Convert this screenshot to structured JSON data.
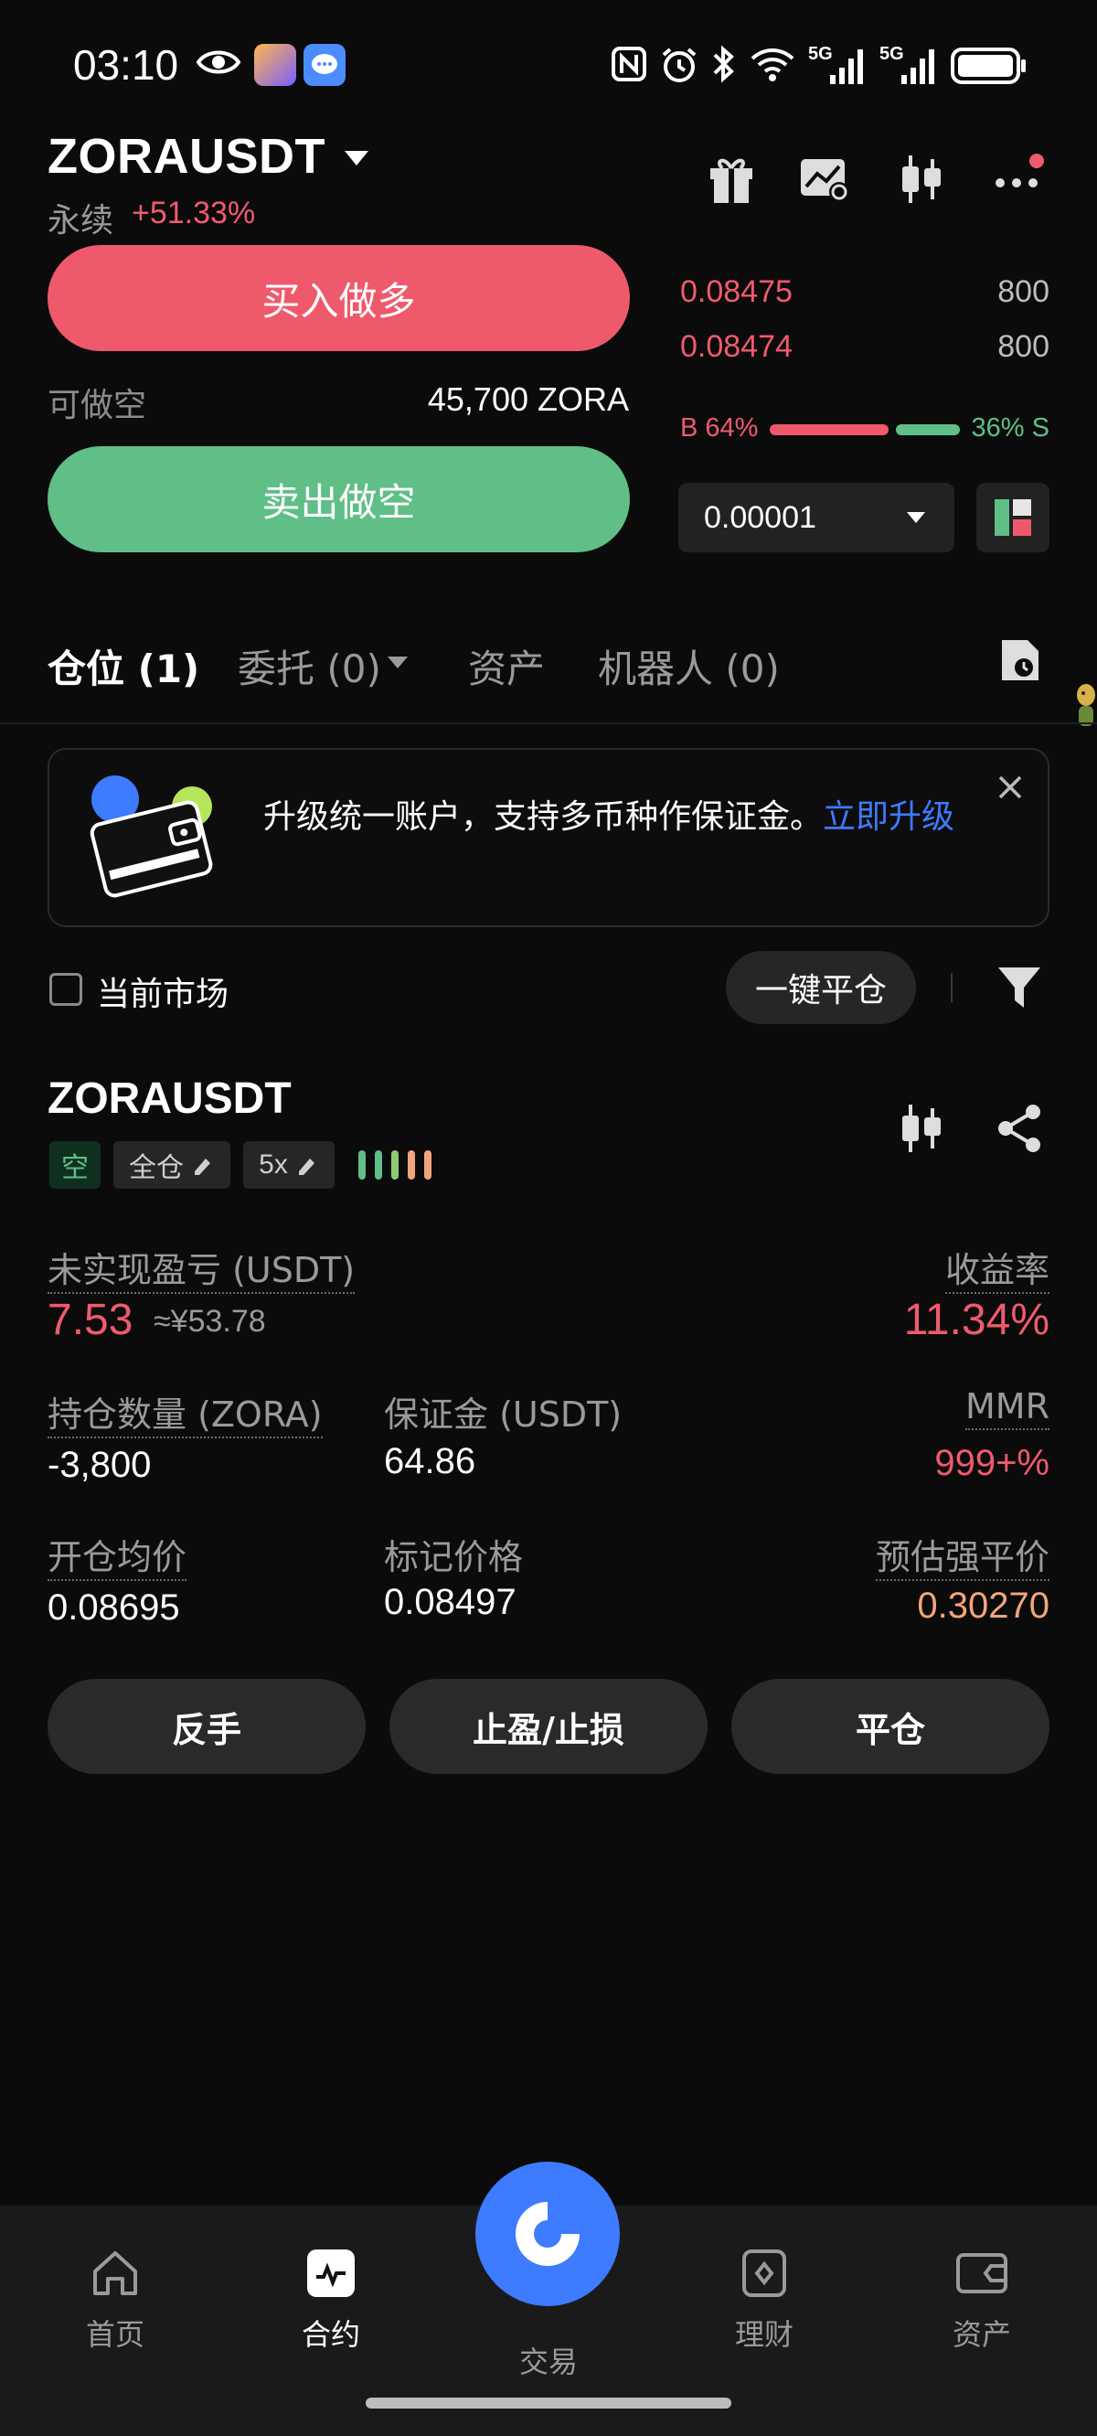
{
  "status_bar": {
    "time": "03:10",
    "icons": [
      "eye-icon",
      "app-icon",
      "message-icon",
      "nfc-icon",
      "alarm-icon",
      "bluetooth-icon",
      "wifi-icon",
      "signal-5g-icon",
      "signal-5g-icon",
      "battery-icon"
    ],
    "network_1": "5G",
    "network_2": "5G"
  },
  "header": {
    "pair": "ZORAUSDT",
    "type": "永续",
    "change": "+51.33%",
    "icons": [
      "gift-icon",
      "chart-settings-icon",
      "candlestick-icon",
      "more-icon"
    ]
  },
  "trade": {
    "buy_long": "买入做多",
    "available_label": "可做空",
    "available_value": "45,700 ZORA",
    "sell_short": "卖出做空"
  },
  "orderbook": {
    "rows": [
      {
        "price": "0.08475",
        "qty": "800"
      },
      {
        "price": "0.08474",
        "qty": "800"
      }
    ],
    "buy_ratio": "B 64%",
    "sell_ratio": "36% S",
    "buy_fraction": 0.64,
    "tick_size": "0.00001"
  },
  "tabs": [
    {
      "label": "仓位 (1)"
    },
    {
      "label": "委托 (0)"
    },
    {
      "label": "资产"
    },
    {
      "label": "机器人 (0)"
    }
  ],
  "banner": {
    "text": "升级统一账户，支持多币种作保证金。",
    "link": "立即升级"
  },
  "filter": {
    "current_market": "当前市场",
    "close_all": "一键平仓"
  },
  "position": {
    "symbol": "ZORAUSDT",
    "side_tag": "空",
    "margin_mode": "全仓",
    "leverage": "5x",
    "unrealized_label": "未实现盈亏 (USDT)",
    "unrealized_value": "7.53",
    "unrealized_cny": "≈¥53.78",
    "roe_label": "收益率",
    "roe_value": "11.34%",
    "size_label": "持仓数量 (ZORA)",
    "size_value": "-3,800",
    "margin_label": "保证金 (USDT)",
    "margin_value": "64.86",
    "mmr_label": "MMR",
    "mmr_value": "999+%",
    "entry_label": "开仓均价",
    "entry_value": "0.08695",
    "mark_label": "标记价格",
    "mark_value": "0.08497",
    "liq_label": "预估强平价",
    "liq_value": "0.30270",
    "risk_colors": [
      "#5fbf87",
      "#5fbf87",
      "#8ccb6e",
      "#f2a57a",
      "#f2a57a"
    ]
  },
  "actions": {
    "reverse": "反手",
    "tpsl": "止盈/止损",
    "close": "平仓"
  },
  "bottom_nav": [
    {
      "label": "首页",
      "icon": "home-icon"
    },
    {
      "label": "合约",
      "icon": "futures-icon"
    },
    {
      "label": "交易",
      "icon": "trade-icon"
    },
    {
      "label": "理财",
      "icon": "earn-icon"
    },
    {
      "label": "资产",
      "icon": "wallet-icon"
    }
  ],
  "colors": {
    "red": "#f05a6e",
    "green": "#5fbf87",
    "accent": "#3d7bff",
    "background": "#0b0b0b"
  }
}
